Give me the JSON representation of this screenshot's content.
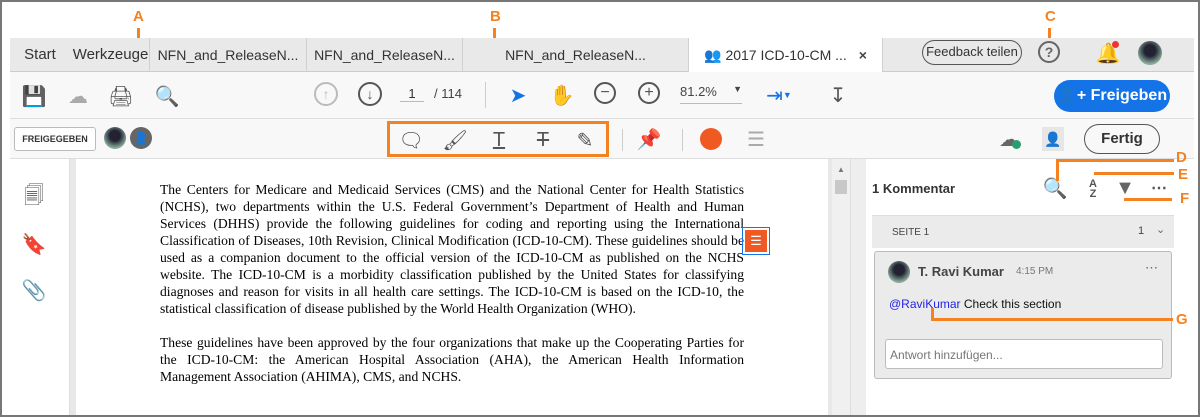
{
  "tabs": {
    "start": "Start",
    "tools": "Werkzeuge",
    "docs": [
      "NFN_and_ReleaseN...",
      "NFN_and_ReleaseN...",
      "NFN_and_ReleaseN..."
    ],
    "active": "2017 ICD-10-CM ...",
    "close": "×"
  },
  "header": {
    "feedback": "Feedback teilen",
    "help": "?"
  },
  "toolbar": {
    "page_current": "1",
    "page_total": "/ 114",
    "zoom": "81.2%",
    "share": "Freigeben"
  },
  "toolbar2": {
    "shared_badge": "FREIGEGEBEN",
    "done": "Fertig"
  },
  "callouts": [
    "A",
    "B",
    "C",
    "D",
    "E",
    "F",
    "G"
  ],
  "document": {
    "paragraphs": [
      "The Centers for Medicare and Medicaid Services (CMS) and the National Center for Health Statistics (NCHS), two departments within the U.S. Federal Government’s Department of Health and Human Services (DHHS) provide the following guidelines for coding and reporting using the International Classification of Diseases, 10th Revision, Clinical Modification (ICD-10-CM). These guidelines should be used as a companion document to the official version of the ICD-10-CM as published on the NCHS website. The ICD-10-CM is a morbidity classification published by the United States for classifying diagnoses and reason for visits in all health care settings.  The ICD-10-CM is based on the ICD-10, the statistical classification of disease published by the World Health Organization (WHO).",
      "These guidelines have been approved by the four organizations that make up the Cooperating Parties for the ICD-10-CM: the American Hospital Association (AHA), the American Health Information Management Association (AHIMA), CMS, and NCHS."
    ]
  },
  "comments": {
    "count_label": "1 Kommentar",
    "section": "SEITE 1",
    "section_count": "1",
    "author": "T. Ravi Kumar",
    "time": "4:15 PM",
    "mention": "@RaviKumar",
    "text": " Check this section",
    "reply_placeholder": "Antwort hinzufügen..."
  },
  "colors": {
    "accent": "#f58220",
    "blue": "#1473e6",
    "red_dot": "#f05a22"
  }
}
